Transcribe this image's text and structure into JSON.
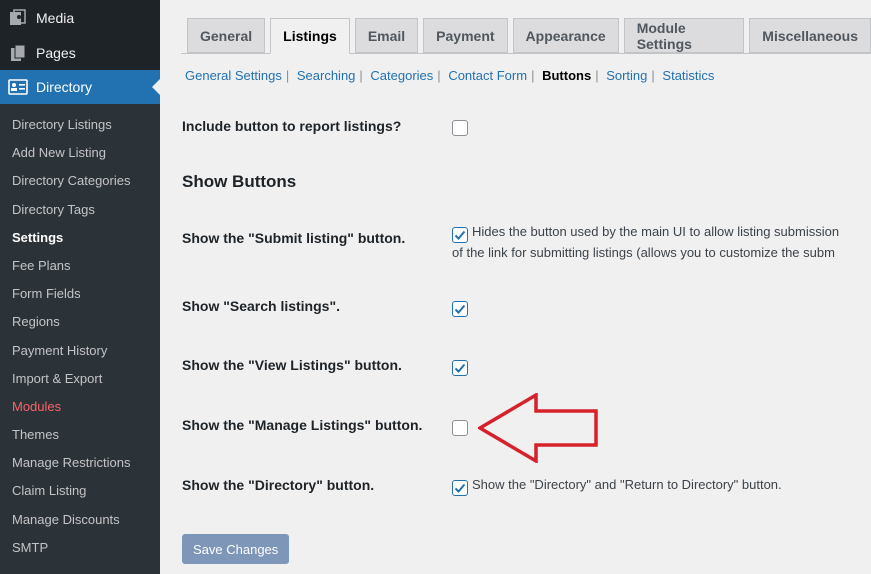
{
  "sidebar": {
    "top": [
      {
        "label": "Media",
        "icon": "media-icon"
      },
      {
        "label": "Pages",
        "icon": "pages-icon"
      },
      {
        "label": "Directory",
        "icon": "directory-icon"
      }
    ],
    "items": [
      {
        "label": "Directory Listings"
      },
      {
        "label": "Add New Listing"
      },
      {
        "label": "Directory Categories"
      },
      {
        "label": "Directory Tags"
      },
      {
        "label": "Settings"
      },
      {
        "label": "Fee Plans"
      },
      {
        "label": "Form Fields"
      },
      {
        "label": "Regions"
      },
      {
        "label": "Payment History"
      },
      {
        "label": "Import & Export"
      },
      {
        "label": "Modules"
      },
      {
        "label": "Themes"
      },
      {
        "label": "Manage Restrictions"
      },
      {
        "label": "Claim Listing"
      },
      {
        "label": "Manage Discounts"
      },
      {
        "label": "SMTP"
      }
    ]
  },
  "tabs": [
    "General",
    "Listings",
    "Email",
    "Payment",
    "Appearance",
    "Module Settings",
    "Miscellaneous"
  ],
  "active_tab": "Listings",
  "subnav": [
    "General Settings",
    "Searching",
    "Categories",
    "Contact Form",
    "Buttons",
    "Sorting",
    "Statistics"
  ],
  "active_subnav": "Buttons",
  "settings": {
    "report": {
      "label": "Include button to report listings?",
      "checked": false
    },
    "heading": "Show Buttons",
    "submit": {
      "label": "Show the \"Submit listing\" button.",
      "checked": true,
      "desc1": "Hides the button used by the main UI to allow listing submission",
      "desc2": "of the link for submitting listings (allows you to customize the subm"
    },
    "search": {
      "label": "Show \"Search listings\".",
      "checked": true
    },
    "view": {
      "label": "Show the \"View Listings\" button.",
      "checked": true
    },
    "manage": {
      "label": "Show the \"Manage Listings\" button.",
      "checked": false
    },
    "directory": {
      "label": "Show the \"Directory\" button.",
      "checked": true,
      "desc": "Show the \"Directory\" and \"Return to Directory\" button."
    }
  },
  "save_label": "Save Changes",
  "colors": {
    "sidebar_bg": "#1d2327",
    "submenu_bg": "#2c3338",
    "accent": "#2271b1",
    "arrow": "#d6202a",
    "modules": "#f86368"
  }
}
